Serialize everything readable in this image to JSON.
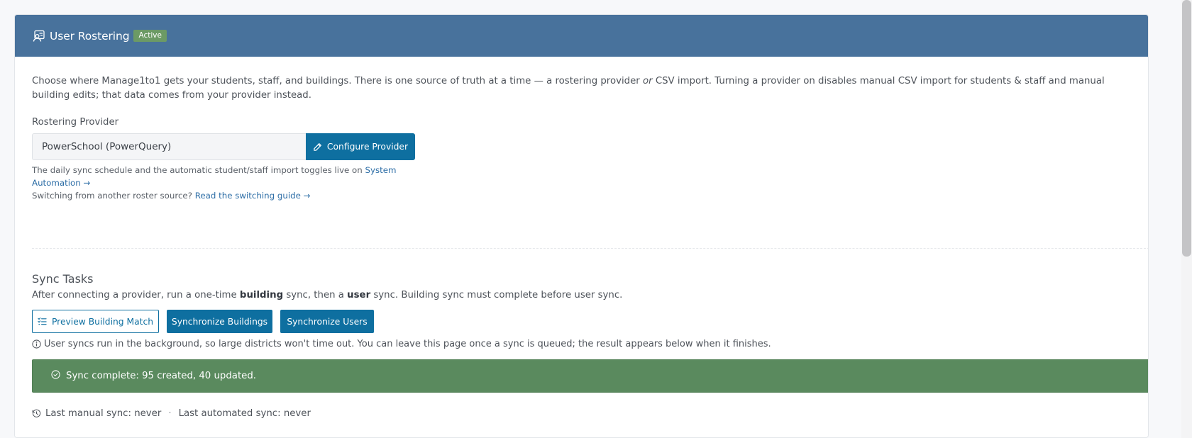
{
  "header": {
    "title": "User Rostering",
    "badge": "Active",
    "icon": "user-rostering-icon",
    "bg_color": "#48729c"
  },
  "intro": {
    "part1": "Choose where Manage1to1 gets your students, staff, and buildings. There is one source of truth at a time — a rostering provider ",
    "emphasis": "or",
    "part2": " CSV import. Turning a provider on disables manual CSV import for students & staff and manual building edits; that data comes from your provider instead."
  },
  "provider": {
    "label": "Rostering Provider",
    "value": "PowerSchool (PowerQuery)",
    "configure_label": "Configure Provider"
  },
  "help": {
    "schedule_text": "The daily sync schedule and the automatic student/staff import toggles live on ",
    "schedule_link": "System Automation →",
    "switch_text": "Switching from another roster source? ",
    "switch_link": "Read the switching guide →"
  },
  "sync": {
    "title": "Sync Tasks",
    "desc_part1": "After connecting a provider, run a one-time ",
    "desc_bold1": "building",
    "desc_part2": " sync, then a ",
    "desc_bold2": "user",
    "desc_part3": " sync. Building sync must complete before user sync.",
    "preview_label": "Preview Building Match",
    "sync_buildings_label": "Synchronize Buildings",
    "sync_users_label": "Synchronize Users",
    "info_text": "User syncs run in the background, so large districts won't time out. You can leave this page once a sync is queued; the result appears below when it finishes.",
    "alert_text": "Sync complete: 95 created, 40 updated.",
    "last_manual": "Last manual sync: never",
    "separator": "·",
    "last_automated": "Last automated sync: never"
  },
  "colors": {
    "primary": "#0e6fa0",
    "success": "#5a8a5e",
    "badge": "#6c9a65"
  }
}
